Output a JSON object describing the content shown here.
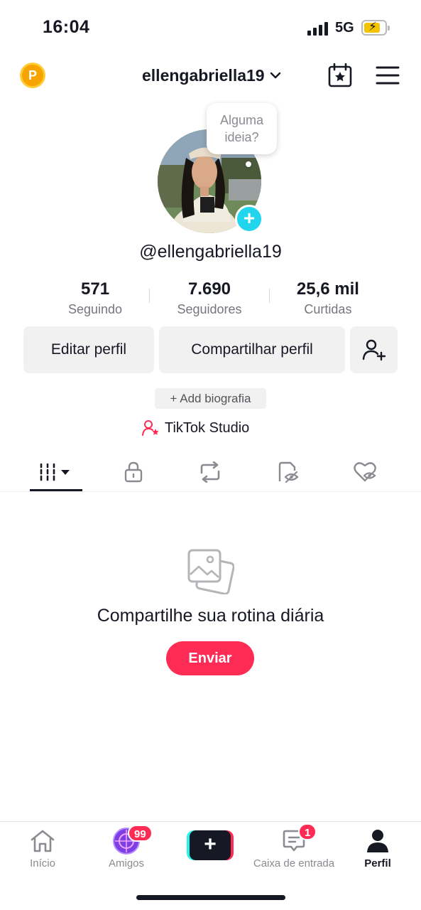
{
  "status_bar": {
    "time": "16:04",
    "network": "5G",
    "battery_icon": "battery-charging-icon"
  },
  "header": {
    "username": "ellengabriella19",
    "coin_letter": "P"
  },
  "profile": {
    "bubble_text_1": "Alguma",
    "bubble_text_2": "ideia?",
    "handle": "@ellengabriella19",
    "avatar_plus": "+"
  },
  "stats": [
    {
      "value": "571",
      "label": "Seguindo"
    },
    {
      "value": "7.690",
      "label": "Seguidores"
    },
    {
      "value": "25,6 mil",
      "label": "Curtidas"
    }
  ],
  "actions": {
    "edit": "Editar perfil",
    "share": "Compartilhar perfil"
  },
  "bio_button": "+ Add biografia",
  "studio_label": "TikTok Studio",
  "tabs": [
    "videos-grid-icon",
    "lock-icon",
    "repost-icon",
    "private-eye-icon",
    "liked-heart-icon"
  ],
  "empty_state": {
    "title": "Compartilhe sua rotina diária",
    "button": "Enviar"
  },
  "bottom_nav": {
    "home": "Início",
    "friends": "Amigos",
    "friends_badge": "99",
    "create": "+",
    "inbox": "Caixa de entrada",
    "inbox_badge": "1",
    "profile": "Perfil"
  },
  "colors": {
    "accent": "#fe2c55",
    "cyan": "#20d5ec",
    "coin": "#f7a400",
    "text": "#161823",
    "muted": "#75767c"
  }
}
